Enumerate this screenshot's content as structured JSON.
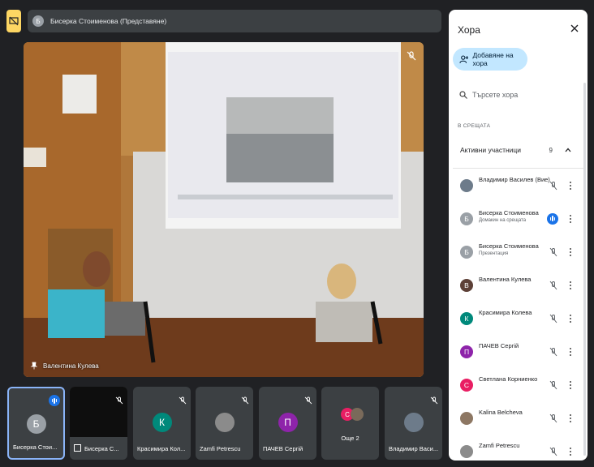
{
  "presenter_chip": {
    "avatar_letter": "Б",
    "label": "Бисерка Стоименова (Представяне)"
  },
  "main_video": {
    "name": "Валентина Кулева"
  },
  "panel": {
    "title": "Хора",
    "add_people": "Добавяне на хора",
    "search_placeholder": "Търсете хора",
    "section": "В СРЕЩАТА",
    "group_label": "Активни участници",
    "group_count": "9",
    "participants": [
      {
        "name": "Владимир Василев (Вие)",
        "sub": "",
        "letter": "",
        "color": "#6d7b8a",
        "photo": true
      },
      {
        "name": "Бисерка Стоименова",
        "sub": "Домакин на срещата",
        "letter": "Б",
        "color": "#9aa0a6",
        "photo": false
      },
      {
        "name": "Бисерка Стоименова",
        "sub": "Презентация",
        "letter": "Б",
        "color": "#9aa0a6",
        "photo": false
      },
      {
        "name": "Валентина Кулева",
        "sub": "",
        "letter": "В",
        "color": "#5d4037",
        "photo": false
      },
      {
        "name": "Красимира Колева",
        "sub": "",
        "letter": "К",
        "color": "#00897b",
        "photo": false
      },
      {
        "name": "ПАЧЕВ Сергій",
        "sub": "",
        "letter": "П",
        "color": "#8e24aa",
        "photo": false
      },
      {
        "name": "Светлана Корниенко",
        "sub": "",
        "letter": "С",
        "color": "#e91e63",
        "photo": false
      },
      {
        "name": "Kalina Belcheva",
        "sub": "",
        "letter": "",
        "color": "#8d7763",
        "photo": true
      },
      {
        "name": "Zamfi Petrescu",
        "sub": "",
        "letter": "",
        "color": "#8b8b8b",
        "photo": true
      }
    ]
  },
  "tiles": [
    {
      "name": "Бисерка Стои...",
      "letter": "Б",
      "color": "#9aa0a6"
    },
    {
      "name": "Бисерка С..."
    },
    {
      "name": "Красимира Кол...",
      "letter": "К",
      "color": "#00897b"
    },
    {
      "name": "Zamfi Petrescu"
    },
    {
      "name": "ПАЧЕВ Сергій",
      "letter": "П",
      "color": "#8e24aa"
    },
    {
      "name": "Още 2",
      "letter": "С"
    },
    {
      "name": "Владимир Васи..."
    }
  ],
  "colors": {
    "accent": "#1a73e8",
    "add_btn": "#c2e7ff",
    "active_tile_border": "#8ab4f8",
    "host_badge": "#fdd663"
  }
}
